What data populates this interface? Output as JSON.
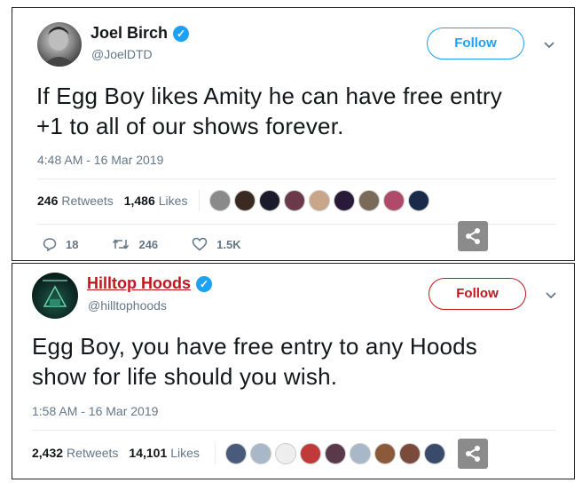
{
  "tweet1": {
    "display_name": "Joel Birch",
    "handle": "@JoelDTD",
    "follow_label": "Follow",
    "text_line1": "If Egg Boy likes Amity he can have free entry",
    "text_line2": "+1 to all of our shows forever.",
    "timestamp": "4:48 AM - 16 Mar 2019",
    "retweets_count": "246",
    "retweets_label": "Retweets",
    "likes_count": "1,486",
    "likes_label": "Likes",
    "liker_colors": [
      "#8a8a8a",
      "#3a2a22",
      "#1b1b2b",
      "#6a3a4a",
      "#c9a58a",
      "#2a1a3a",
      "#7a6a5a",
      "#b04a6a",
      "#1a2a4a"
    ],
    "actions": {
      "reply_count": "18",
      "retweet_count": "246",
      "like_count": "1.5K"
    }
  },
  "tweet2": {
    "display_name": "Hilltop Hoods",
    "handle": "@hilltophoods",
    "follow_label": "Follow",
    "text_line1": "Egg Boy, you have free entry to any Hoods",
    "text_line2": "show for life should you wish.",
    "timestamp": "1:58 AM - 16 Mar 2019",
    "retweets_count": "2,432",
    "retweets_label": "Retweets",
    "likes_count": "14,101",
    "likes_label": "Likes",
    "liker_colors": [
      "#4a5a7a",
      "#a8b8c8",
      "#eeeeee",
      "#c03a3a",
      "#5a3a4a",
      "#a8b8c8",
      "#8a5a3a",
      "#7a4a3a",
      "#3a4a6a"
    ]
  },
  "colors": {
    "twitter_blue": "#1da1f2",
    "brand_red": "#c0161d"
  }
}
